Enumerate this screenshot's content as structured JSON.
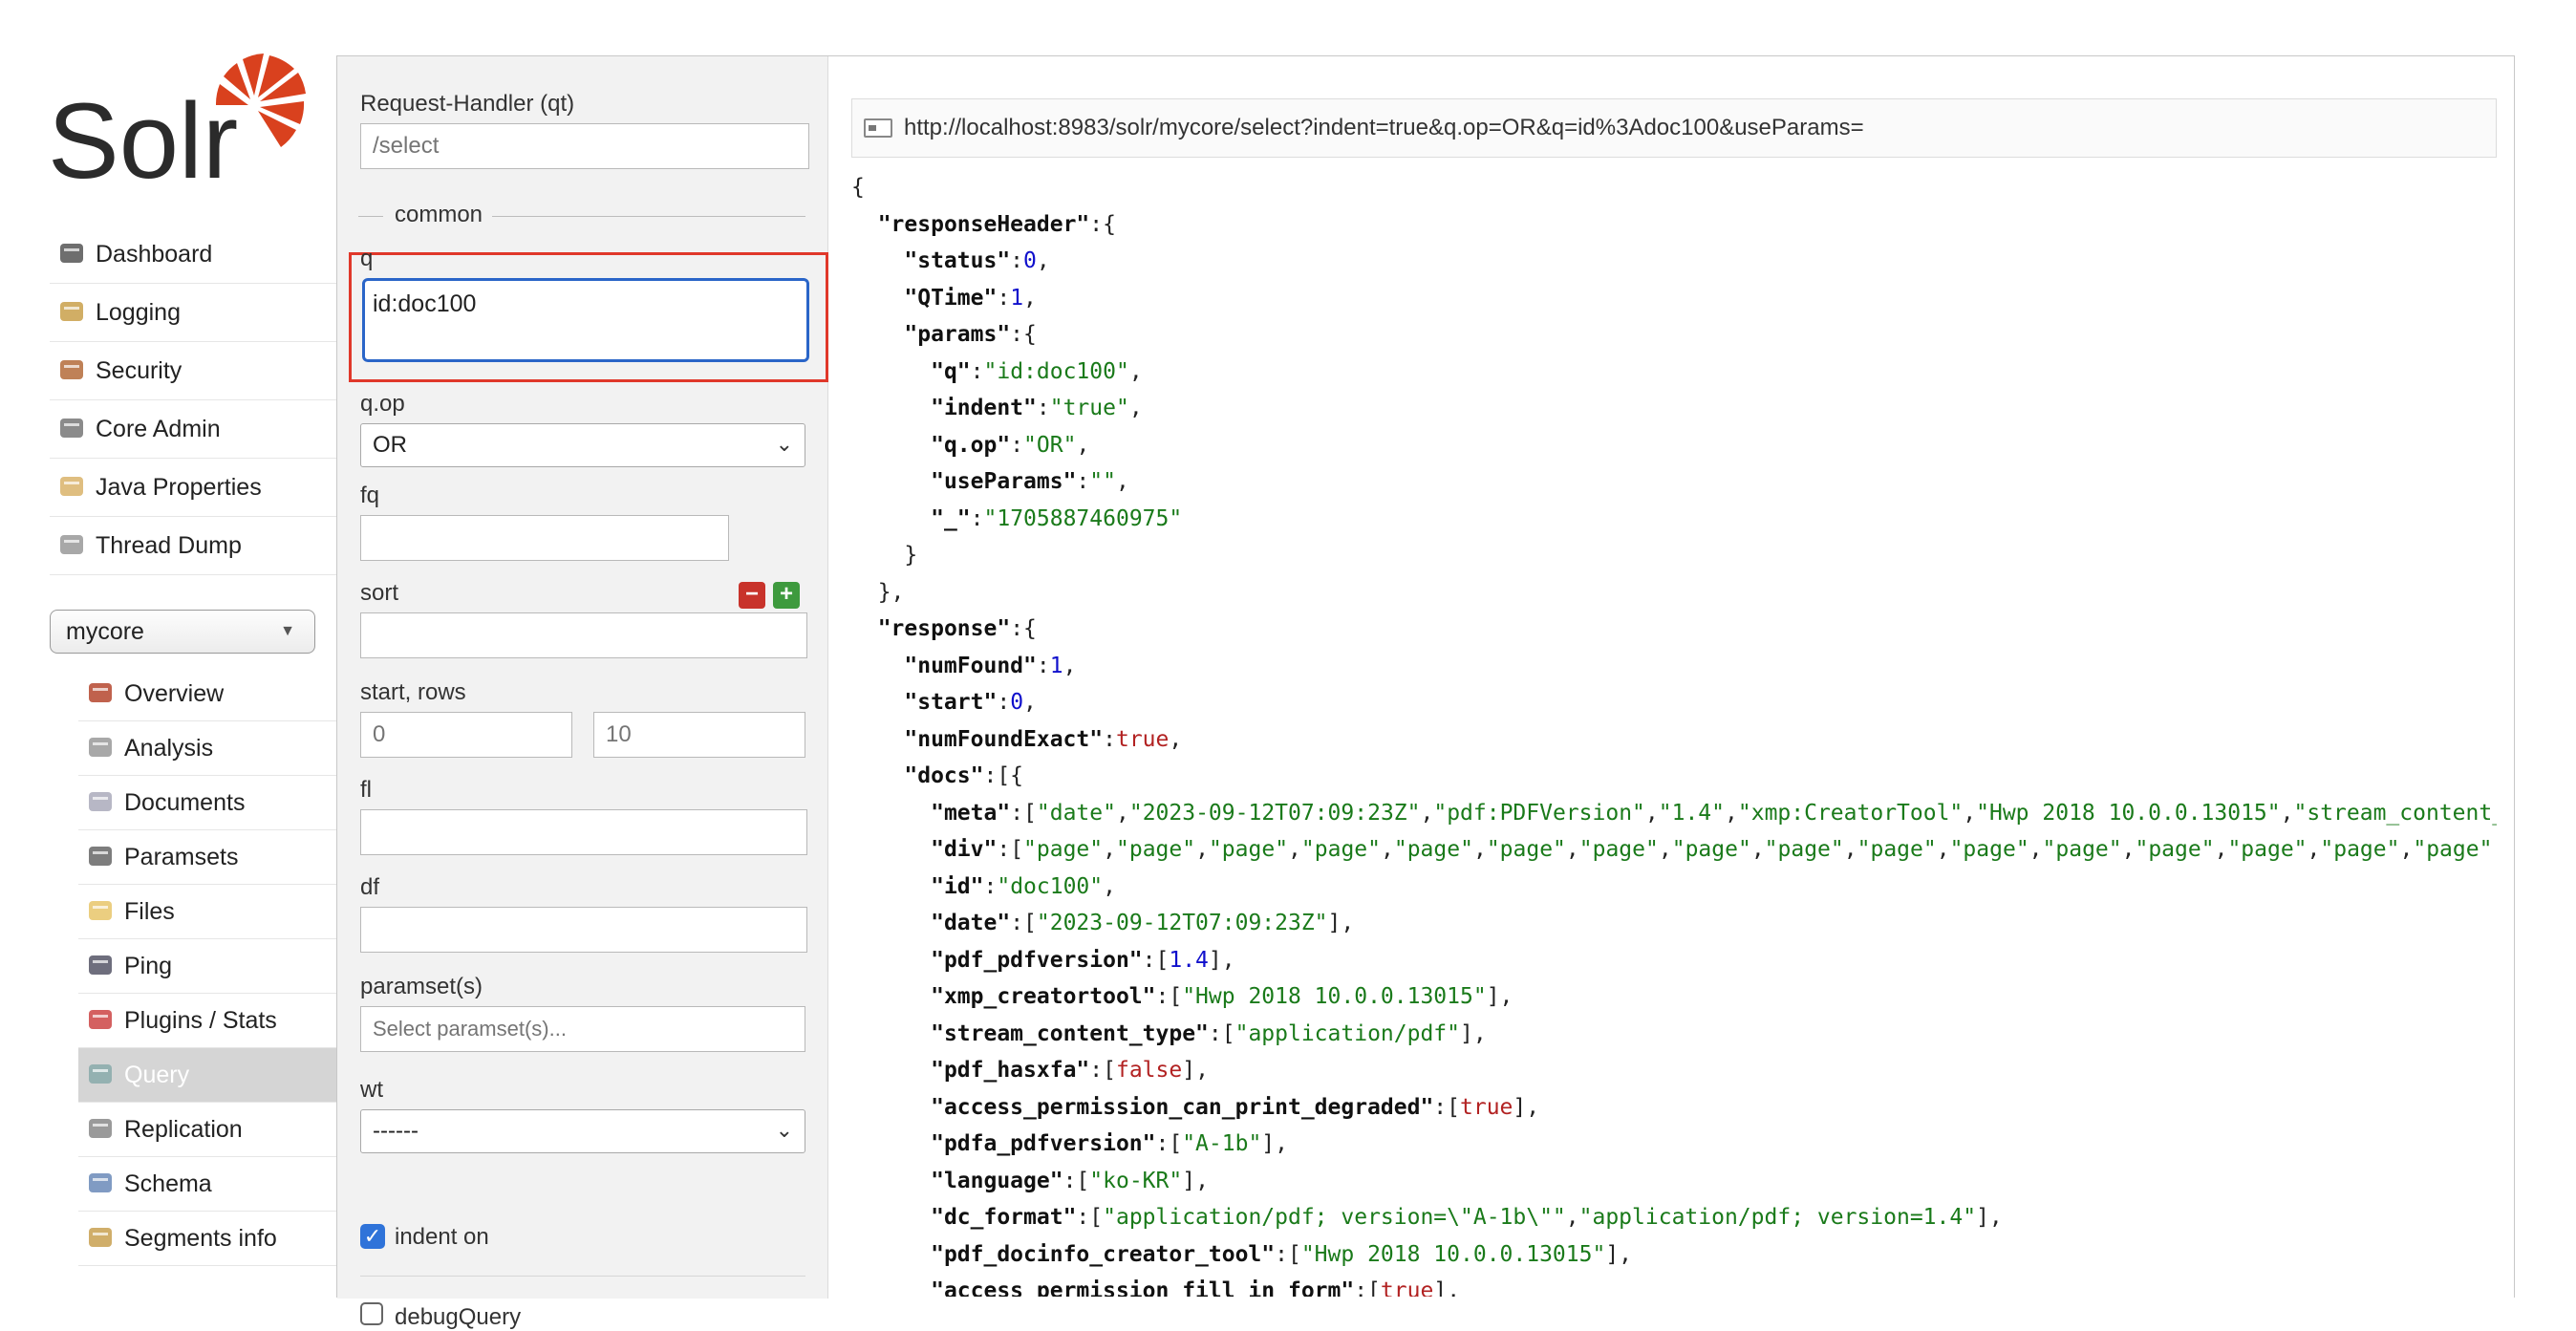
{
  "logo_text": "Solr",
  "sidebar": {
    "main_items": [
      {
        "label": "Dashboard",
        "icon": "dashboard-icon"
      },
      {
        "label": "Logging",
        "icon": "logging-icon"
      },
      {
        "label": "Security",
        "icon": "security-icon"
      },
      {
        "label": "Core Admin",
        "icon": "core-admin-icon"
      },
      {
        "label": "Java Properties",
        "icon": "java-properties-icon"
      },
      {
        "label": "Thread Dump",
        "icon": "thread-dump-icon"
      }
    ],
    "core_selector": "mycore",
    "core_items": [
      {
        "label": "Overview",
        "icon": "overview-icon"
      },
      {
        "label": "Analysis",
        "icon": "analysis-icon"
      },
      {
        "label": "Documents",
        "icon": "documents-icon"
      },
      {
        "label": "Paramsets",
        "icon": "paramsets-icon"
      },
      {
        "label": "Files",
        "icon": "files-icon"
      },
      {
        "label": "Ping",
        "icon": "ping-icon"
      },
      {
        "label": "Plugins / Stats",
        "icon": "plugins-icon"
      },
      {
        "label": "Query",
        "icon": "query-icon"
      },
      {
        "label": "Replication",
        "icon": "replication-icon"
      },
      {
        "label": "Schema",
        "icon": "schema-icon"
      },
      {
        "label": "Segments info",
        "icon": "segments-icon"
      }
    ],
    "active_core_item": "Query"
  },
  "form": {
    "request_handler_label": "Request-Handler (qt)",
    "request_handler_placeholder": "/select",
    "common_legend": "common",
    "q_label": "q",
    "q_value": "id:doc100",
    "qop_label": "q.op",
    "qop_value": "OR",
    "fq_label": "fq",
    "sort_label": "sort",
    "start_rows_label": "start, rows",
    "start_placeholder": "0",
    "rows_placeholder": "10",
    "fl_label": "fl",
    "df_label": "df",
    "paramsets_label": "paramset(s)",
    "paramsets_placeholder": "Select paramset(s)...",
    "wt_label": "wt",
    "wt_value": "------",
    "indent_label": "indent on",
    "indent_checked": true,
    "debug_label": "debugQuery",
    "debug_checked": false
  },
  "result": {
    "url": "http://localhost:8983/solr/mycore/select?indent=true&q.op=OR&q=id%3Adoc100&useParams=",
    "json_lines": [
      [
        [
          "p",
          "{"
        ]
      ],
      [
        [
          "p",
          "  "
        ],
        [
          "k",
          "\"responseHeader\""
        ],
        [
          "p",
          ":{"
        ]
      ],
      [
        [
          "p",
          "    "
        ],
        [
          "k",
          "\"status\""
        ],
        [
          "p",
          ":"
        ],
        [
          "n",
          "0"
        ],
        [
          "p",
          ","
        ]
      ],
      [
        [
          "p",
          "    "
        ],
        [
          "k",
          "\"QTime\""
        ],
        [
          "p",
          ":"
        ],
        [
          "n",
          "1"
        ],
        [
          "p",
          ","
        ]
      ],
      [
        [
          "p",
          "    "
        ],
        [
          "k",
          "\"params\""
        ],
        [
          "p",
          ":{"
        ]
      ],
      [
        [
          "p",
          "      "
        ],
        [
          "k",
          "\"q\""
        ],
        [
          "p",
          ":"
        ],
        [
          "s",
          "\"id:doc100\""
        ],
        [
          "p",
          ","
        ]
      ],
      [
        [
          "p",
          "      "
        ],
        [
          "k",
          "\"indent\""
        ],
        [
          "p",
          ":"
        ],
        [
          "s",
          "\"true\""
        ],
        [
          "p",
          ","
        ]
      ],
      [
        [
          "p",
          "      "
        ],
        [
          "k",
          "\"q.op\""
        ],
        [
          "p",
          ":"
        ],
        [
          "s",
          "\"OR\""
        ],
        [
          "p",
          ","
        ]
      ],
      [
        [
          "p",
          "      "
        ],
        [
          "k",
          "\"useParams\""
        ],
        [
          "p",
          ":"
        ],
        [
          "s",
          "\"\""
        ],
        [
          "p",
          ","
        ]
      ],
      [
        [
          "p",
          "      "
        ],
        [
          "k",
          "\"_\""
        ],
        [
          "p",
          ":"
        ],
        [
          "s",
          "\"1705887460975\""
        ]
      ],
      [
        [
          "p",
          "    }"
        ]
      ],
      [
        [
          "p",
          "  },"
        ]
      ],
      [
        [
          "p",
          "  "
        ],
        [
          "k",
          "\"response\""
        ],
        [
          "p",
          ":{"
        ]
      ],
      [
        [
          "p",
          "    "
        ],
        [
          "k",
          "\"numFound\""
        ],
        [
          "p",
          ":"
        ],
        [
          "n",
          "1"
        ],
        [
          "p",
          ","
        ]
      ],
      [
        [
          "p",
          "    "
        ],
        [
          "k",
          "\"start\""
        ],
        [
          "p",
          ":"
        ],
        [
          "n",
          "0"
        ],
        [
          "p",
          ","
        ]
      ],
      [
        [
          "p",
          "    "
        ],
        [
          "k",
          "\"numFoundExact\""
        ],
        [
          "p",
          ":"
        ],
        [
          "b",
          "true"
        ],
        [
          "p",
          ","
        ]
      ],
      [
        [
          "p",
          "    "
        ],
        [
          "k",
          "\"docs\""
        ],
        [
          "p",
          ":[{"
        ]
      ],
      [
        [
          "p",
          "      "
        ],
        [
          "k",
          "\"meta\""
        ],
        [
          "p",
          ":["
        ],
        [
          "s",
          "\"date\""
        ],
        [
          "p",
          ","
        ],
        [
          "s",
          "\"2023-09-12T07:09:23Z\""
        ],
        [
          "p",
          ","
        ],
        [
          "s",
          "\"pdf:PDFVersion\""
        ],
        [
          "p",
          ","
        ],
        [
          "s",
          "\"1.4\""
        ],
        [
          "p",
          ","
        ],
        [
          "s",
          "\"xmp:CreatorTool\""
        ],
        [
          "p",
          ","
        ],
        [
          "s",
          "\"Hwp 2018 10.0.0.13015\""
        ],
        [
          "p",
          ","
        ],
        [
          "s",
          "\"stream_content_type\""
        ]
      ],
      [
        [
          "p",
          "      "
        ],
        [
          "k",
          "\"div\""
        ],
        [
          "p",
          ":["
        ],
        [
          "s",
          "\"page\""
        ],
        [
          "p",
          ","
        ],
        [
          "s",
          "\"page\""
        ],
        [
          "p",
          ","
        ],
        [
          "s",
          "\"page\""
        ],
        [
          "p",
          ","
        ],
        [
          "s",
          "\"page\""
        ],
        [
          "p",
          ","
        ],
        [
          "s",
          "\"page\""
        ],
        [
          "p",
          ","
        ],
        [
          "s",
          "\"page\""
        ],
        [
          "p",
          ","
        ],
        [
          "s",
          "\"page\""
        ],
        [
          "p",
          ","
        ],
        [
          "s",
          "\"page\""
        ],
        [
          "p",
          ","
        ],
        [
          "s",
          "\"page\""
        ],
        [
          "p",
          ","
        ],
        [
          "s",
          "\"page\""
        ],
        [
          "p",
          ","
        ],
        [
          "s",
          "\"page\""
        ],
        [
          "p",
          ","
        ],
        [
          "s",
          "\"page\""
        ],
        [
          "p",
          ","
        ],
        [
          "s",
          "\"page\""
        ],
        [
          "p",
          ","
        ],
        [
          "s",
          "\"page\""
        ],
        [
          "p",
          ","
        ],
        [
          "s",
          "\"page\""
        ],
        [
          "p",
          ","
        ],
        [
          "s",
          "\"page\""
        ]
      ],
      [
        [
          "p",
          "      "
        ],
        [
          "k",
          "\"id\""
        ],
        [
          "p",
          ":"
        ],
        [
          "s",
          "\"doc100\""
        ],
        [
          "p",
          ","
        ]
      ],
      [
        [
          "p",
          "      "
        ],
        [
          "k",
          "\"date\""
        ],
        [
          "p",
          ":["
        ],
        [
          "s",
          "\"2023-09-12T07:09:23Z\""
        ],
        [
          "p",
          "],"
        ]
      ],
      [
        [
          "p",
          "      "
        ],
        [
          "k",
          "\"pdf_pdfversion\""
        ],
        [
          "p",
          ":["
        ],
        [
          "n",
          "1.4"
        ],
        [
          "p",
          "],"
        ]
      ],
      [
        [
          "p",
          "      "
        ],
        [
          "k",
          "\"xmp_creatortool\""
        ],
        [
          "p",
          ":["
        ],
        [
          "s",
          "\"Hwp 2018 10.0.0.13015\""
        ],
        [
          "p",
          "],"
        ]
      ],
      [
        [
          "p",
          "      "
        ],
        [
          "k",
          "\"stream_content_type\""
        ],
        [
          "p",
          ":["
        ],
        [
          "s",
          "\"application/pdf\""
        ],
        [
          "p",
          "],"
        ]
      ],
      [
        [
          "p",
          "      "
        ],
        [
          "k",
          "\"pdf_hasxfa\""
        ],
        [
          "p",
          ":["
        ],
        [
          "b",
          "false"
        ],
        [
          "p",
          "],"
        ]
      ],
      [
        [
          "p",
          "      "
        ],
        [
          "k",
          "\"access_permission_can_print_degraded\""
        ],
        [
          "p",
          ":["
        ],
        [
          "b",
          "true"
        ],
        [
          "p",
          "],"
        ]
      ],
      [
        [
          "p",
          "      "
        ],
        [
          "k",
          "\"pdfa_pdfversion\""
        ],
        [
          "p",
          ":["
        ],
        [
          "s",
          "\"A-1b\""
        ],
        [
          "p",
          "],"
        ]
      ],
      [
        [
          "p",
          "      "
        ],
        [
          "k",
          "\"language\""
        ],
        [
          "p",
          ":["
        ],
        [
          "s",
          "\"ko-KR\""
        ],
        [
          "p",
          "],"
        ]
      ],
      [
        [
          "p",
          "      "
        ],
        [
          "k",
          "\"dc_format\""
        ],
        [
          "p",
          ":["
        ],
        [
          "s",
          "\"application/pdf; version=\\\"A-1b\\\"\""
        ],
        [
          "p",
          ","
        ],
        [
          "s",
          "\"application/pdf; version=1.4\""
        ],
        [
          "p",
          "],"
        ]
      ],
      [
        [
          "p",
          "      "
        ],
        [
          "k",
          "\"pdf_docinfo_creator_tool\""
        ],
        [
          "p",
          ":["
        ],
        [
          "s",
          "\"Hwp 2018 10.0.0.13015\""
        ],
        [
          "p",
          "],"
        ]
      ],
      [
        [
          "p",
          "      "
        ],
        [
          "k",
          "\"access_permission_fill_in_form\""
        ],
        [
          "p",
          ":["
        ],
        [
          "b",
          "true"
        ],
        [
          "p",
          "],"
        ]
      ]
    ]
  }
}
